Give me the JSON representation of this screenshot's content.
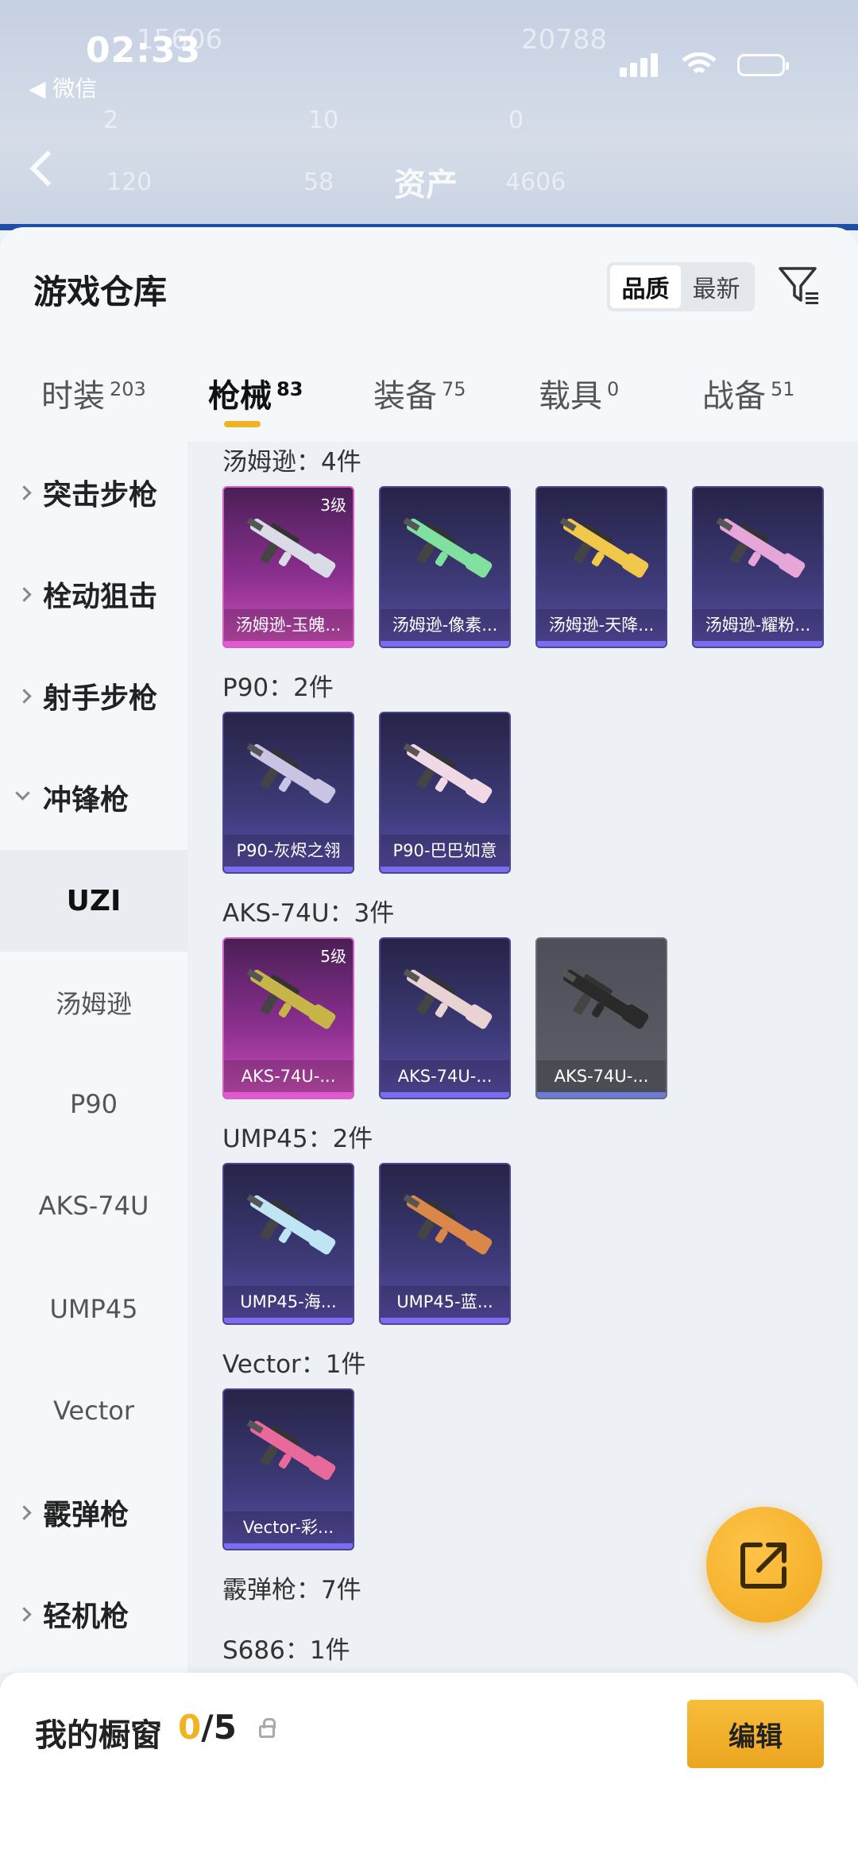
{
  "status_bar": {
    "time": "02:33",
    "back_app": "◀ 微信"
  },
  "background_header": {
    "title": "资产",
    "ghost_stats": [
      "15606",
      "20788",
      "2",
      "10",
      "0",
      "120",
      "58",
      "4606"
    ]
  },
  "panel": {
    "title": "游戏仓库",
    "sort_options": [
      {
        "label": "品质",
        "active": true
      },
      {
        "label": "最新",
        "active": false
      }
    ]
  },
  "tabs": [
    {
      "label": "时装",
      "count": "203",
      "active": false
    },
    {
      "label": "枪械",
      "count": "83",
      "active": true
    },
    {
      "label": "装备",
      "count": "75",
      "active": false
    },
    {
      "label": "载具",
      "count": "0",
      "active": false
    },
    {
      "label": "战备",
      "count": "51",
      "active": false
    }
  ],
  "sidebar": {
    "items": [
      {
        "label": "突击步枪",
        "type": "category",
        "expanded": false
      },
      {
        "label": "栓动狙击",
        "type": "category",
        "expanded": false
      },
      {
        "label": "射手步枪",
        "type": "category",
        "expanded": false
      },
      {
        "label": "冲锋枪",
        "type": "category",
        "expanded": true
      },
      {
        "label": "UZI",
        "type": "sub",
        "active": true
      },
      {
        "label": "汤姆逊",
        "type": "sub",
        "active": false
      },
      {
        "label": "P90",
        "type": "sub",
        "active": false
      },
      {
        "label": "AKS-74U",
        "type": "sub",
        "active": false
      },
      {
        "label": "UMP45",
        "type": "sub",
        "active": false
      },
      {
        "label": "Vector",
        "type": "sub",
        "active": false
      },
      {
        "label": "霰弹枪",
        "type": "category",
        "expanded": false
      },
      {
        "label": "轻机枪",
        "type": "category",
        "expanded": false
      }
    ]
  },
  "groups": [
    {
      "title": "汤姆逊：4件",
      "items": [
        {
          "name": "汤姆逊-玉魄...",
          "rarity": "pink",
          "level": "3级",
          "gun_color": "#d9dbe6"
        },
        {
          "name": "汤姆逊-像素...",
          "rarity": "purple",
          "level": "",
          "gun_color": "#7fe0a0"
        },
        {
          "name": "汤姆逊-天降...",
          "rarity": "purple",
          "level": "",
          "gun_color": "#f2c84b"
        },
        {
          "name": "汤姆逊-耀粉...",
          "rarity": "purple",
          "level": "",
          "gun_color": "#e6a6d8"
        }
      ]
    },
    {
      "title": "P90：2件",
      "items": [
        {
          "name": "P90-灰烬之翎",
          "rarity": "purple",
          "level": "",
          "gun_color": "#c9c4e4"
        },
        {
          "name": "P90-巴巴如意",
          "rarity": "purple",
          "level": "",
          "gun_color": "#f0d8e4"
        }
      ]
    },
    {
      "title": "AKS-74U：3件",
      "items": [
        {
          "name": "AKS-74U-...",
          "rarity": "pink",
          "level": "5级",
          "gun_color": "#c8b54a"
        },
        {
          "name": "AKS-74U-...",
          "rarity": "purple",
          "level": "",
          "gun_color": "#e8d2d2"
        },
        {
          "name": "AKS-74U-...",
          "rarity": "grey",
          "level": "",
          "gun_color": "#2a2a2a"
        }
      ]
    },
    {
      "title": "UMP45：2件",
      "items": [
        {
          "name": "UMP45-海...",
          "rarity": "purple",
          "level": "",
          "gun_color": "#bfe4f4"
        },
        {
          "name": "UMP45-蓝...",
          "rarity": "purple",
          "level": "",
          "gun_color": "#d9884a"
        }
      ]
    },
    {
      "title": "Vector：1件",
      "items": [
        {
          "name": "Vector-彩...",
          "rarity": "purple",
          "level": "",
          "gun_color": "#e86a9a"
        }
      ]
    },
    {
      "title": "霰弹枪：7件",
      "items": []
    },
    {
      "title": "S686：1件",
      "items": []
    }
  ],
  "bottom_bar": {
    "label": "我的橱窗",
    "current": "0",
    "total": "/5",
    "edit_label": "编辑"
  },
  "colors": {
    "accent": "#f0b323",
    "purple_card": "#3d3a78",
    "pink_card": "#cb4fb6"
  }
}
